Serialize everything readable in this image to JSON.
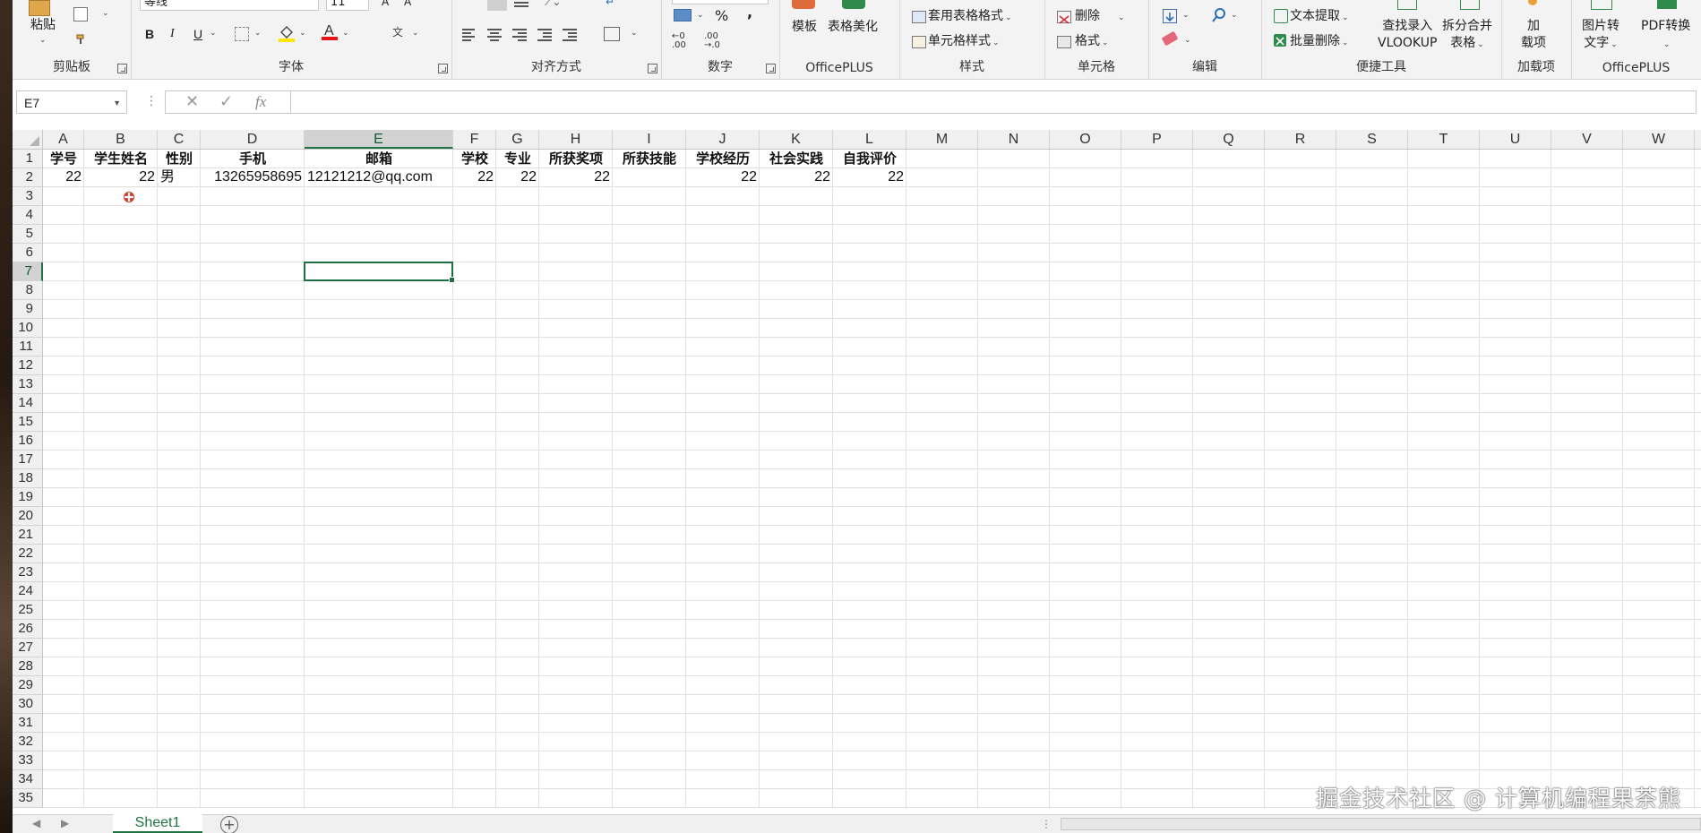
{
  "ribbon": {
    "clipboard": {
      "paste_label": "粘贴",
      "group_label": "剪贴板"
    },
    "font": {
      "font_name": "等线",
      "font_size": "11",
      "bold": "B",
      "italic": "I",
      "underline": "U",
      "group_label": "字体"
    },
    "alignment": {
      "group_label": "对齐方式"
    },
    "number": {
      "percent": "%",
      "comma": ",",
      "group_label": "数字"
    },
    "officeplus": {
      "template_label": "模板",
      "beautify_label": "表格美化",
      "group_label": "OfficePLUS"
    },
    "styles": {
      "table_format_label": "套用表格格式",
      "cell_style_label": "单元格样式",
      "group_label": "样式"
    },
    "cells": {
      "delete_label": "删除",
      "format_label": "格式",
      "group_label": "单元格"
    },
    "editing": {
      "group_label": "编辑"
    },
    "quicktools": {
      "text_extract_label": "文本提取",
      "batch_delete_label": "批量删除",
      "lookup_line1": "查找录入",
      "lookup_line2": "VLOOKUP",
      "split_line1": "拆分合并",
      "split_line2": "表格",
      "group_label": "便捷工具"
    },
    "addins": {
      "line1": "加",
      "line2": "载项",
      "group_label": "加载项"
    },
    "officeplus2": {
      "img_line1": "图片转",
      "img_line2": "文字",
      "pdf_label": "PDF转换",
      "group_label": "OfficePLUS"
    }
  },
  "formula_bar": {
    "name_box": "E7",
    "formula": ""
  },
  "sheet": {
    "columns": [
      "A",
      "B",
      "C",
      "D",
      "E",
      "F",
      "G",
      "H",
      "I",
      "J",
      "K",
      "L",
      "M",
      "N",
      "O",
      "P",
      "Q",
      "R",
      "S",
      "T",
      "U",
      "V",
      "W"
    ],
    "active_column": "E",
    "active_row": 7,
    "row_count": 35,
    "header_row": [
      "学号",
      "学生姓名",
      "性别",
      "手机",
      "邮箱",
      "学校",
      "专业",
      "所获奖项",
      "所获技能",
      "学校经历",
      "社会实践",
      "自我评价"
    ],
    "data_row": [
      "22",
      "22",
      "男",
      "13265958695",
      "12121212@qq.com",
      "22",
      "22",
      "22",
      "",
      "22",
      "22",
      "22"
    ]
  },
  "tabs": {
    "sheet_name": "Sheet1",
    "add_symbol": "+"
  },
  "watermark": "掘金技术社区 @ 计算机编程果茶熊"
}
